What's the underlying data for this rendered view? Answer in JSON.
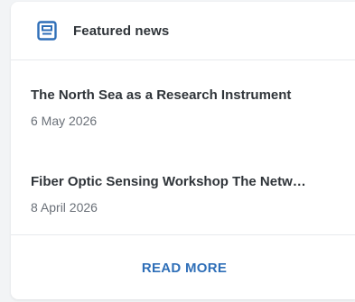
{
  "widget": {
    "title": "Featured news",
    "icon": "newspaper-icon",
    "accent_color": "#2f6fb8"
  },
  "news": [
    {
      "title": "The North Sea as a Research Instrument",
      "date": "6 May 2026"
    },
    {
      "title": "Fiber Optic Sensing Workshop The Netw…",
      "date": "8 April 2026"
    }
  ],
  "footer": {
    "read_more_label": "READ MORE"
  }
}
